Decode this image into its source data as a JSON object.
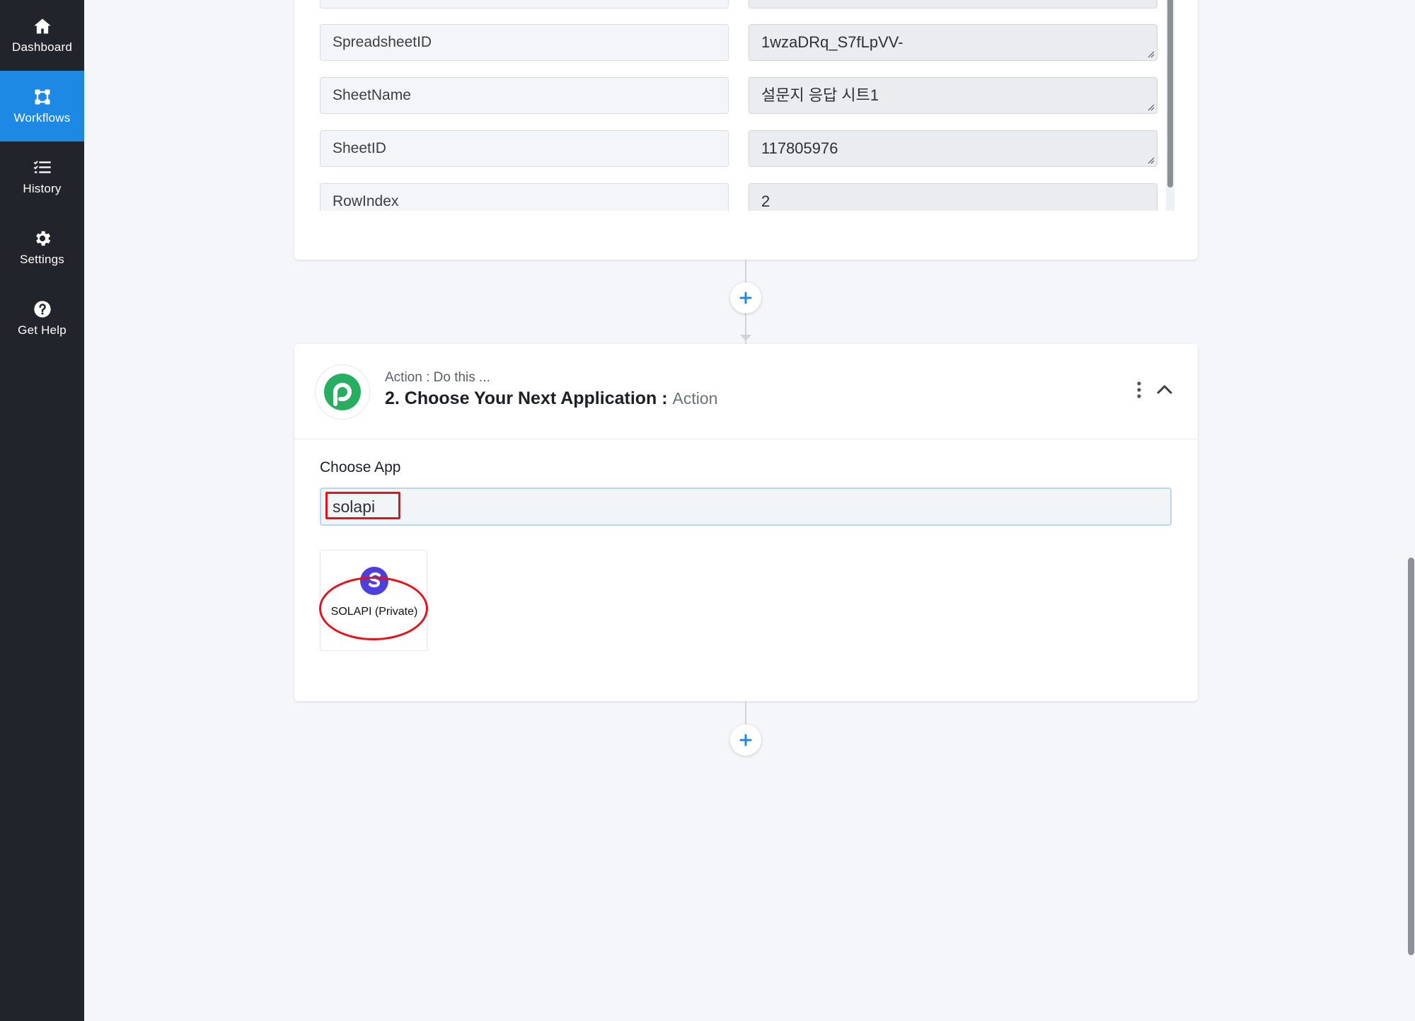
{
  "sidebar": {
    "items": [
      {
        "label": "Dashboard",
        "icon": "home-icon",
        "active": false
      },
      {
        "label": "Workflows",
        "icon": "workflow-icon",
        "active": true
      },
      {
        "label": "History",
        "icon": "list-check-icon",
        "active": false
      },
      {
        "label": "Settings",
        "icon": "gear-icon",
        "active": false
      },
      {
        "label": "Get Help",
        "icon": "question-circle-icon",
        "active": false
      }
    ]
  },
  "trigger_fields": [
    {
      "key": "SpreadsheetID",
      "value": "1wzaDRq_S7fLpVV-"
    },
    {
      "key": "SheetName",
      "value": "설문지 응답 시트1"
    },
    {
      "key": "SheetID",
      "value": "117805976"
    },
    {
      "key": "RowIndex",
      "value": "2"
    }
  ],
  "action": {
    "subtitle": "Action : Do this ...",
    "title": "2. Choose Your Next Application :",
    "title_suffix": "Action",
    "choose_app_label": "Choose App",
    "search_value": "solapi",
    "results": [
      {
        "label": "SOLAPI (Private)",
        "icon": "solapi-icon"
      }
    ]
  },
  "colors": {
    "sidebar_bg": "#21252b",
    "active_nav": "#1e88e5",
    "accent_plus": "#1e88e5",
    "highlight_red": "#e3121b",
    "pabbly_green": "#27ae60"
  }
}
